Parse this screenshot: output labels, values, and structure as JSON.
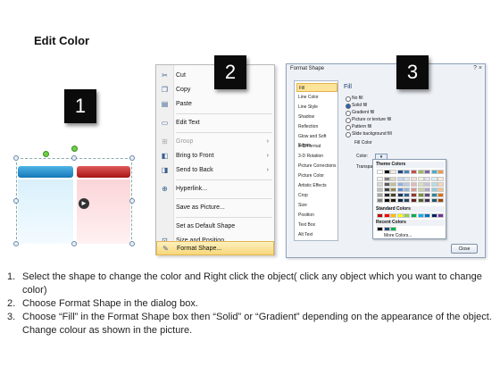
{
  "heading": "Edit Color",
  "badges": [
    "1",
    "2",
    "3"
  ],
  "context_menu": {
    "items": [
      {
        "label": "Cut",
        "icon": "scissors-icon"
      },
      {
        "label": "Copy",
        "icon": "copy-icon"
      },
      {
        "label": "Paste",
        "icon": "paste-icon"
      },
      {
        "label": "Edit Text",
        "icon": "edit-text-icon"
      },
      {
        "label": "Group",
        "icon": "group-icon"
      },
      {
        "label": "Bring to Front",
        "icon": "bring-front-icon"
      },
      {
        "label": "Send to Back",
        "icon": "send-back-icon"
      },
      {
        "label": "Hyperlink...",
        "icon": "hyperlink-icon"
      },
      {
        "label": "Save as Picture...",
        "icon": ""
      },
      {
        "label": "Set as Default Shape",
        "icon": ""
      },
      {
        "label": "Size and Position...",
        "icon": "size-icon"
      },
      {
        "label": "Format Shape...",
        "icon": "format-icon"
      }
    ]
  },
  "dialog": {
    "title": "Format Shape",
    "controls": "? ×",
    "categories": [
      "Fill",
      "Line Color",
      "Line Style",
      "Shadow",
      "Reflection",
      "Glow and Soft Edges",
      "3-D Format",
      "3-D Rotation",
      "Picture Corrections",
      "Picture Color",
      "Artistic Effects",
      "Crop",
      "Size",
      "Position",
      "Text Box",
      "Alt Text"
    ],
    "selected_category": "Fill",
    "pane_heading": "Fill",
    "fill_options": [
      "No fill",
      "Solid fill",
      "Gradient fill",
      "Picture or texture fill",
      "Pattern fill",
      "Slide background fill"
    ],
    "selected_fill": "Solid fill",
    "fill_color_label": "Fill Color",
    "color_label": "Color:",
    "transparency_label": "Transpa",
    "theme_colors_label": "Theme Colors",
    "standard_colors_label": "Standard Colors",
    "recent_colors_label": "Recent Colors",
    "more_colors_label": "More Colors...",
    "close_label": "Close",
    "theme_top_row": [
      "#ffffff",
      "#000000",
      "#eeece1",
      "#1f497d",
      "#4f81bd",
      "#c0504d",
      "#9bbb59",
      "#8064a2",
      "#4bacc6",
      "#f79646"
    ],
    "theme_shades": [
      [
        "#f2f2f2",
        "#7f7f7f",
        "#ddd9c3",
        "#c6d9f0",
        "#dbe5f1",
        "#f2dcdb",
        "#ebf1dd",
        "#e5e0ec",
        "#dbeef3",
        "#fdeada"
      ],
      [
        "#d8d8d8",
        "#595959",
        "#c4bd97",
        "#8db3e2",
        "#b8cce4",
        "#e5b9b7",
        "#d7e3bc",
        "#ccc1d9",
        "#b7dde8",
        "#fbd5b5"
      ],
      [
        "#bfbfbf",
        "#3f3f3f",
        "#938953",
        "#548dd4",
        "#95b3d7",
        "#d99694",
        "#c3d69b",
        "#b2a2c7",
        "#92cddc",
        "#fac08f"
      ],
      [
        "#a5a5a5",
        "#262626",
        "#494429",
        "#17365d",
        "#366092",
        "#953734",
        "#76923c",
        "#5f497a",
        "#31859b",
        "#e36c09"
      ],
      [
        "#7f7f7f",
        "#0c0c0c",
        "#1d1b10",
        "#0f243e",
        "#244061",
        "#632423",
        "#4f6128",
        "#3f3151",
        "#205867",
        "#974806"
      ]
    ],
    "standard_colors": [
      "#c00000",
      "#ff0000",
      "#ffc000",
      "#ffff00",
      "#92d050",
      "#00b050",
      "#00b0f0",
      "#0070c0",
      "#002060",
      "#7030a0"
    ],
    "recent_colors": [
      "#000000",
      "#1f497d",
      "#00b050"
    ]
  },
  "instructions": [
    {
      "num": "1.",
      "text": "Select the shape to change the color and Right click the object( click any object which you want to change color)"
    },
    {
      "num": "2.",
      "text": "Choose Format Shape in the dialog box."
    },
    {
      "num": "3.",
      "text": "Choose “Fill” in the Format Shape box then “Solid” or “Gradient” depending on the appearance of the object. Change colour as shown in the picture."
    }
  ]
}
